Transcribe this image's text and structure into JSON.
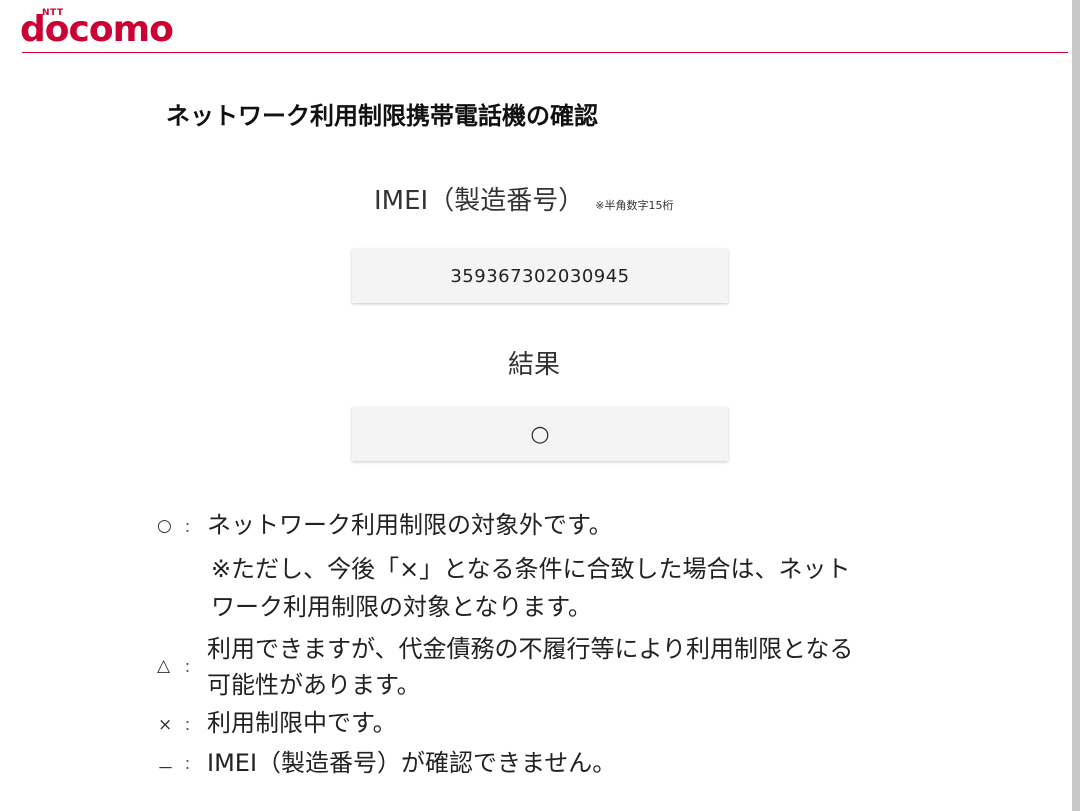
{
  "brand": {
    "ntt": "NTT",
    "logo_text": "docomo",
    "brand_color": "#cc0033"
  },
  "page_title": "ネットワーク利用制限携帯電話機の確認",
  "imei": {
    "label": "IMEI（製造番号）",
    "note": "※半角数字15桁",
    "value": "359367302030945"
  },
  "result": {
    "label": "結果",
    "value": "○"
  },
  "legend": {
    "circle": {
      "symbol": "○",
      "sep": "：",
      "text": "ネットワーク利用制限の対象外です。",
      "note_line1": "※ただし、今後「×」となる条件に合致した場合は、ネット",
      "note_line2": "ワーク利用制限の対象となります。"
    },
    "triangle": {
      "symbol": "△",
      "sep": "：",
      "line1": "利用できますが、代金債務の不履行等により利用制限となる",
      "line2": "可能性があります。"
    },
    "cross": {
      "symbol": "×",
      "sep": "：",
      "text": "利用制限中です。"
    },
    "dash": {
      "symbol": "－",
      "sep": "：",
      "text": "IMEI（製造番号）が確認できません。"
    }
  }
}
